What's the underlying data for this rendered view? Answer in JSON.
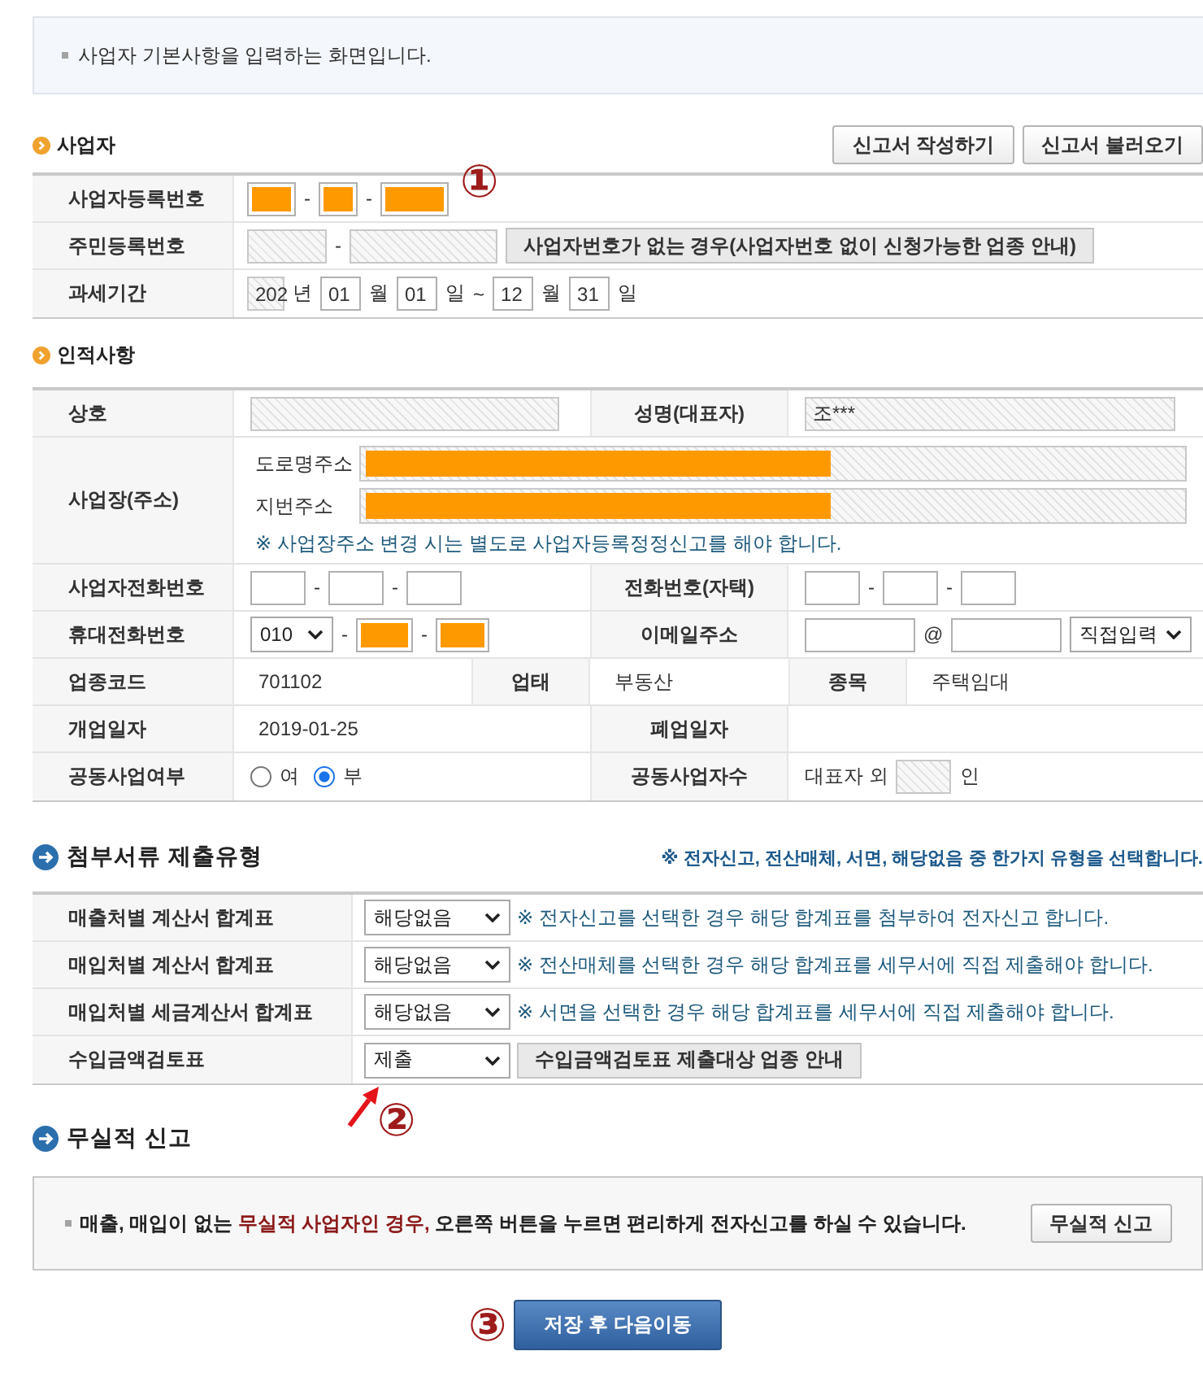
{
  "notice": {
    "text": "사업자 기본사항을 입력하는 화면입니다."
  },
  "business": {
    "title": "사업자",
    "buttons": [
      "신고서 작성하기",
      "신고서 불러오기"
    ],
    "rows": [
      {
        "label": "사업자등록번호",
        "parts": [
          {
            "kind": "input",
            "disabled": false,
            "redacted": true
          },
          {
            "kind": "text",
            "text": "-"
          },
          {
            "kind": "input",
            "disabled": false,
            "redacted": true
          },
          {
            "kind": "text",
            "text": "-"
          },
          {
            "kind": "input",
            "disabled": false,
            "redacted": true
          },
          {
            "kind": "annotation",
            "text": "①"
          }
        ]
      },
      {
        "label": "주민등록번호",
        "parts": [
          {
            "kind": "input",
            "disabled": true,
            "redacted": false
          },
          {
            "kind": "text",
            "text": "-"
          },
          {
            "kind": "input",
            "disabled": true,
            "redacted": false
          },
          {
            "kind": "button",
            "text": "사업자번호가 없는 경우(사업자번호 없이 신청가능한 업종 안내)"
          }
        ]
      },
      {
        "label": "과세기간",
        "parts": [
          {
            "kind": "input",
            "value": "202",
            "disabled": true,
            "redacted": false
          },
          {
            "kind": "text",
            "text": "년"
          },
          {
            "kind": "input",
            "value": "01",
            "disabled": false,
            "redacted": false
          },
          {
            "kind": "text",
            "text": "월"
          },
          {
            "kind": "input",
            "value": "01",
            "disabled": false,
            "redacted": false
          },
          {
            "kind": "text",
            "text": "일"
          },
          {
            "kind": "text",
            "text": "~"
          },
          {
            "kind": "input",
            "value": "12",
            "disabled": false,
            "redacted": false
          },
          {
            "kind": "text",
            "text": "월"
          },
          {
            "kind": "input",
            "value": "31",
            "disabled": false,
            "redacted": false
          },
          {
            "kind": "text",
            "text": "일"
          }
        ]
      }
    ]
  },
  "personal": {
    "title": "인적사항",
    "rows": [
      {
        "cells": [
          {
            "kind": "label",
            "text": "상호"
          },
          {
            "kind": "fields",
            "parts": [
              {
                "kind": "input",
                "disabled": true,
                "redacted": false
              }
            ]
          },
          {
            "kind": "label",
            "text": "성명(대표자)"
          },
          {
            "kind": "fields",
            "parts": [
              {
                "kind": "input",
                "value": "조***",
                "disabled": true,
                "redacted": false
              }
            ]
          }
        ]
      },
      {
        "cells": [
          {
            "kind": "label",
            "text": "사업장(주소)"
          },
          {
            "kind": "address",
            "lines": [
              {
                "label": "도로명주소",
                "disabled": true,
                "redacted": true
              },
              {
                "label": "지번주소",
                "disabled": true,
                "redacted": true
              }
            ],
            "note": "※ 사업장주소 변경 시는 별도로 사업자등록정정신고를 해야 합니다."
          }
        ]
      },
      {
        "cells": [
          {
            "kind": "label",
            "text": "사업자전화번호"
          },
          {
            "kind": "fields",
            "parts": [
              {
                "kind": "input",
                "disabled": false,
                "redacted": false
              },
              {
                "kind": "text",
                "text": "-"
              },
              {
                "kind": "input",
                "disabled": false,
                "redacted": false
              },
              {
                "kind": "text",
                "text": "-"
              },
              {
                "kind": "input",
                "disabled": false,
                "redacted": false
              }
            ]
          },
          {
            "kind": "label",
            "text": "전화번호(자택)"
          },
          {
            "kind": "fields",
            "parts": [
              {
                "kind": "input",
                "disabled": false,
                "redacted": false
              },
              {
                "kind": "text",
                "text": "-"
              },
              {
                "kind": "input",
                "disabled": false,
                "redacted": false
              },
              {
                "kind": "text",
                "text": "-"
              },
              {
                "kind": "input",
                "disabled": false,
                "redacted": false
              }
            ]
          }
        ]
      },
      {
        "cells": [
          {
            "kind": "label",
            "text": "휴대전화번호"
          },
          {
            "kind": "fields",
            "parts": [
              {
                "kind": "select",
                "value": "010"
              },
              {
                "kind": "text",
                "text": "-"
              },
              {
                "kind": "input",
                "disabled": false,
                "redacted": true
              },
              {
                "kind": "text",
                "text": "-"
              },
              {
                "kind": "input",
                "disabled": false,
                "redacted": true
              }
            ]
          },
          {
            "kind": "label",
            "text": "이메일주소"
          },
          {
            "kind": "fields",
            "parts": [
              {
                "kind": "input",
                "disabled": false,
                "redacted": false
              },
              {
                "kind": "text",
                "text": "@"
              },
              {
                "kind": "input",
                "disabled": false,
                "redacted": false
              },
              {
                "kind": "select",
                "value": "직접입력"
              }
            ]
          }
        ]
      },
      {
        "cells": [
          {
            "kind": "label",
            "text": "업종코드"
          },
          {
            "kind": "pair",
            "items": [
              {
                "kind": "value",
                "text": "701102"
              },
              {
                "kind": "label",
                "text": "업태"
              }
            ]
          },
          {
            "kind": "value",
            "text": "부동산"
          },
          {
            "kind": "pair",
            "items": [
              {
                "kind": "label",
                "text": "종목"
              },
              {
                "kind": "value",
                "text": "주택임대"
              }
            ]
          }
        ]
      },
      {
        "cells": [
          {
            "kind": "label",
            "text": "개업일자"
          },
          {
            "kind": "value",
            "text": "2019-01-25"
          },
          {
            "kind": "label",
            "text": "폐업일자"
          },
          {
            "kind": "value"
          }
        ]
      },
      {
        "cells": [
          {
            "kind": "label",
            "text": "공동사업여부"
          },
          {
            "kind": "fields",
            "parts": [
              {
                "kind": "radio",
                "text": "여",
                "selected": false
              },
              {
                "kind": "radio",
                "text": "부",
                "selected": true
              }
            ]
          },
          {
            "kind": "label",
            "text": "공동사업자수"
          },
          {
            "kind": "fields",
            "parts": [
              {
                "kind": "text",
                "text": "대표자 외"
              },
              {
                "kind": "input",
                "disabled": true,
                "redacted": false
              },
              {
                "kind": "text",
                "text": "인"
              }
            ]
          }
        ]
      }
    ]
  },
  "attachments": {
    "title": "첨부서류 제출유형",
    "note": "※ 전자신고, 전산매체, 서면, 해당없음 중 한가지 유형을 선택합니다.",
    "rows": [
      {
        "label": "매출처별 계산서 합계표",
        "select": "해당없음",
        "note": "※ 전자신고를 선택한 경우 해당 합계표를 첨부하여 전자신고 합니다."
      },
      {
        "label": "매입처별 계산서 합계표",
        "select": "해당없음",
        "note": "※ 전산매체를 선택한 경우 해당 합계표를 세무서에 직접 제출해야 합니다."
      },
      {
        "label": "매입처별 세금계산서 합계표",
        "select": "해당없음",
        "note": "※ 서면을 선택한 경우 해당 합계표를 세무서에 직접 제출해야 합니다."
      },
      {
        "label": "수입금액검토표",
        "select": "제출",
        "button": "수입금액검토표 제출대상 업종 안내"
      }
    ],
    "annotation": "②"
  },
  "no_record": {
    "title": "무실적 신고",
    "message": [
      {
        "text": "매출, 매입이 없는",
        "highlight": false
      },
      {
        "text": "무실적 사업자인 경우,",
        "highlight": true
      },
      {
        "text": "오른쪽 버튼을 누르면 편리하게 전자신고를 하실 수 있습니다.",
        "highlight": false
      }
    ],
    "button": "무실적 신고"
  },
  "save": {
    "button": "저장 후 다음이동",
    "annotation": "③"
  }
}
